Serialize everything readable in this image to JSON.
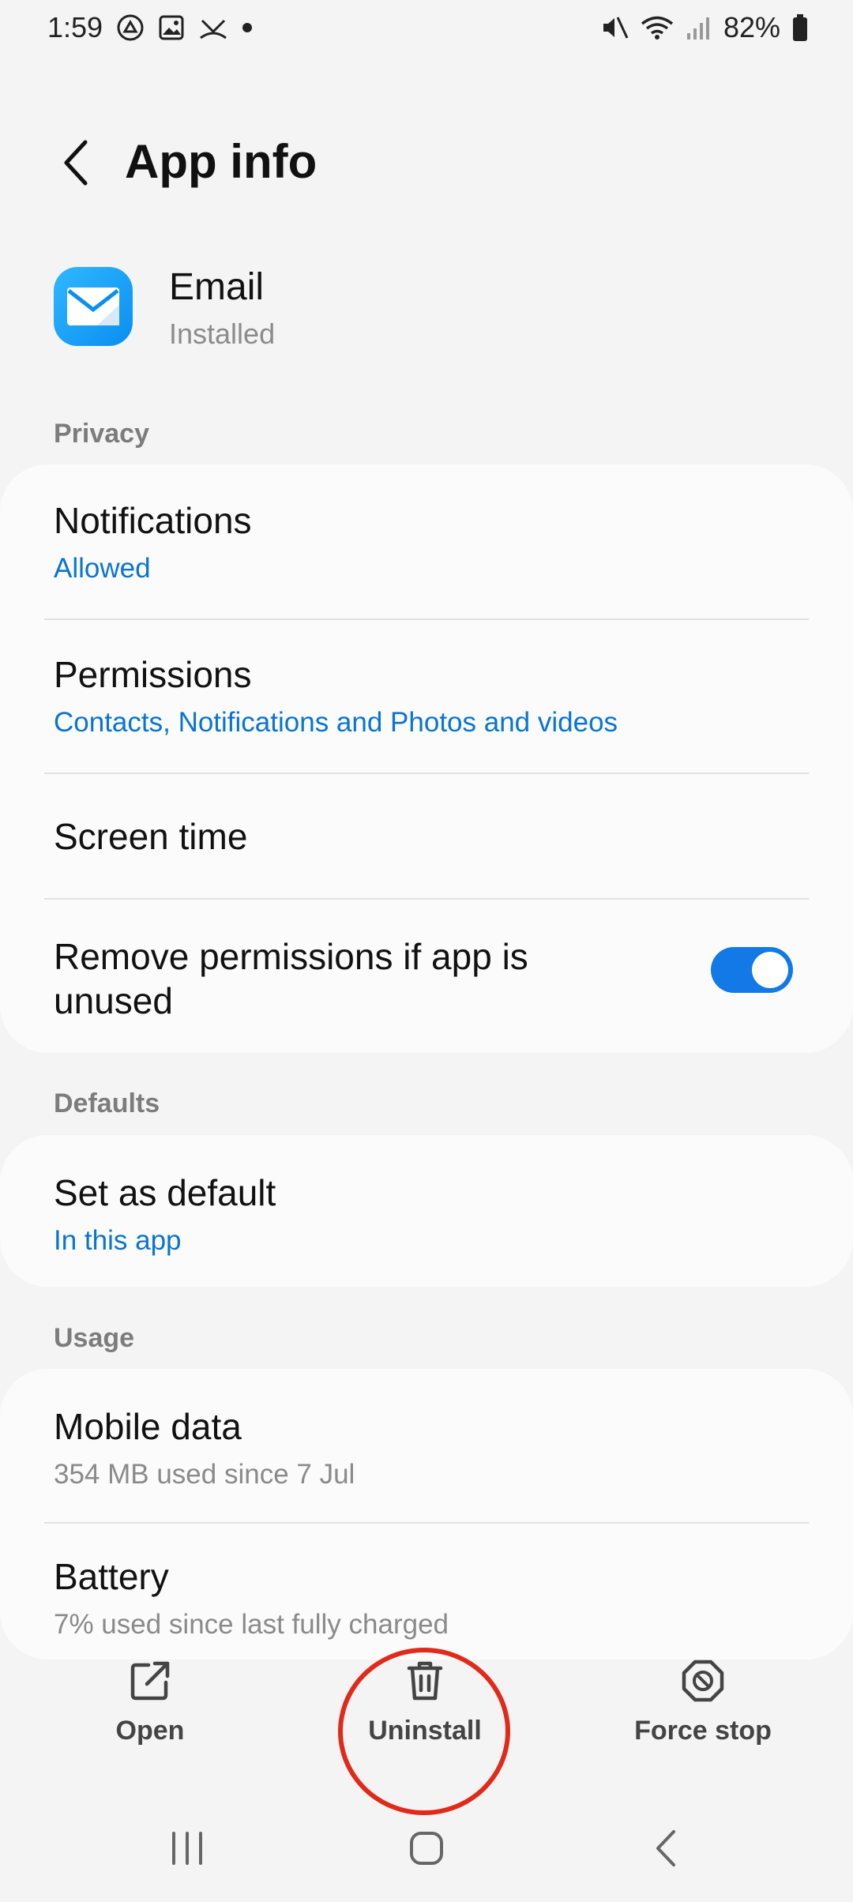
{
  "status_bar": {
    "time": "1:59",
    "battery": "82%",
    "icons_left": [
      "drive-icon",
      "gallery-icon",
      "missed-call-icon",
      "dot-icon"
    ],
    "icons_right": [
      "mute-icon",
      "wifi-icon",
      "signal-icon",
      "battery-icon"
    ]
  },
  "header": {
    "title": "App info"
  },
  "app": {
    "name": "Email",
    "status": "Installed",
    "icon": "email-app-icon"
  },
  "sections": {
    "privacy": "Privacy",
    "defaults": "Defaults",
    "usage": "Usage"
  },
  "privacy_items": {
    "notifications_title": "Notifications",
    "notifications_sub": "Allowed",
    "permissions_title": "Permissions",
    "permissions_sub": "Contacts, Notifications and Photos and videos",
    "screen_time_title": "Screen time",
    "remove_permissions_title": "Remove permissions if app is unused",
    "remove_permissions_on": true
  },
  "defaults_items": {
    "set_default_title": "Set as default",
    "set_default_sub": "In this app"
  },
  "usage_items": {
    "mobile_data_title": "Mobile data",
    "mobile_data_sub": "354 MB used since 7 Jul",
    "battery_title": "Battery",
    "battery_sub": "7% used since last fully charged"
  },
  "actions": {
    "open": "Open",
    "uninstall": "Uninstall",
    "force_stop": "Force stop"
  },
  "colors": {
    "accent": "#1379e6",
    "link": "#0a74d0",
    "highlight_circle": "#e02a1a"
  }
}
